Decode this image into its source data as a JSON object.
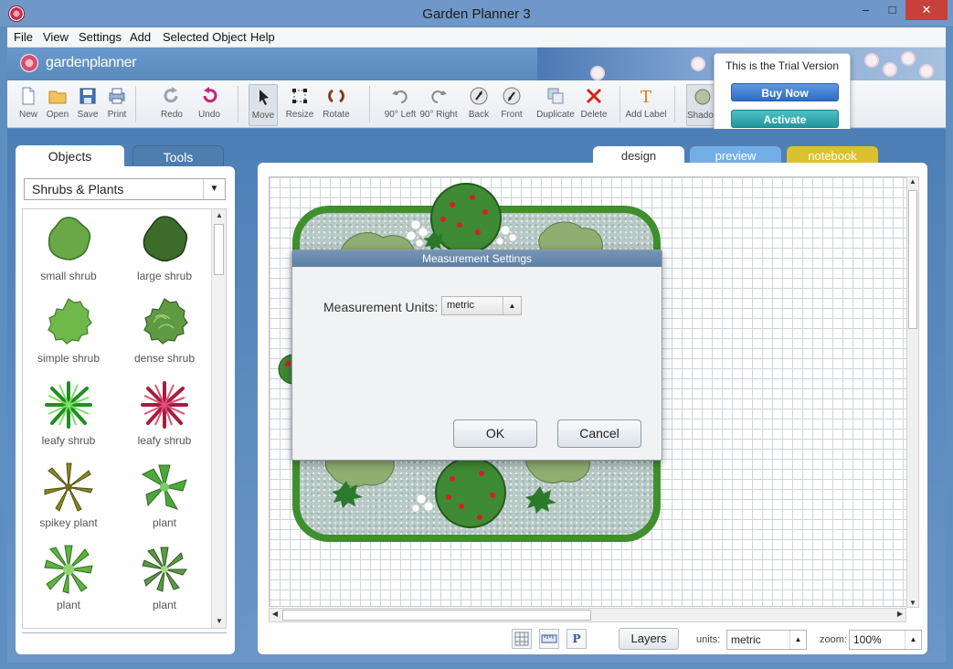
{
  "window": {
    "title": "Garden Planner 3",
    "minimize": "–",
    "maximize": "□",
    "close": "✕"
  },
  "menu": {
    "items": [
      "File",
      "View",
      "Settings",
      "Add",
      "Selected Object",
      "Help"
    ]
  },
  "brand": {
    "logo_text": "gardenplanner"
  },
  "toolbar": {
    "tools": [
      {
        "label": "New",
        "icon": "new-document-icon"
      },
      {
        "label": "Open",
        "icon": "open-folder-icon"
      },
      {
        "label": "Save",
        "icon": "save-disk-icon"
      },
      {
        "label": "Print",
        "icon": "printer-icon"
      },
      {
        "label": "Redo",
        "icon": "redo-icon"
      },
      {
        "label": "Undo",
        "icon": "undo-icon"
      },
      {
        "label": "Move",
        "icon": "pointer-arrow-icon",
        "active": true
      },
      {
        "label": "Resize",
        "icon": "resize-icon"
      },
      {
        "label": "Rotate",
        "icon": "rotate-icon"
      },
      {
        "label": "90° Left",
        "icon": "rotate-left-icon"
      },
      {
        "label": "90° Right",
        "icon": "rotate-right-icon"
      },
      {
        "label": "Back",
        "icon": "send-back-icon"
      },
      {
        "label": "Front",
        "icon": "bring-front-icon"
      },
      {
        "label": "Duplicate",
        "icon": "duplicate-icon"
      },
      {
        "label": "Delete",
        "icon": "delete-x-icon"
      },
      {
        "label": "Add Label",
        "icon": "text-label-icon"
      },
      {
        "label": "Shadow",
        "icon": "shadow-icon"
      }
    ]
  },
  "trial": {
    "message": "This is the Trial Version",
    "buy_label": "Buy Now",
    "activate_label": "Activate"
  },
  "left_panel": {
    "tabs": {
      "objects": "Objects",
      "tools": "Tools"
    },
    "category": "Shrubs & Plants",
    "items": [
      {
        "label": "small shrub"
      },
      {
        "label": "large shrub"
      },
      {
        "label": "simple shrub"
      },
      {
        "label": "dense shrub"
      },
      {
        "label": "leafy shrub"
      },
      {
        "label": "leafy shrub"
      },
      {
        "label": "spikey plant"
      },
      {
        "label": "plant"
      },
      {
        "label": "plant"
      },
      {
        "label": "plant"
      }
    ]
  },
  "view_tabs": {
    "design": "design",
    "preview": "preview",
    "notebook": "notebook"
  },
  "dialog": {
    "title": "Measurement Settings",
    "units_label": "Measurement Units:",
    "units_value": "metric",
    "ok_label": "OK",
    "cancel_label": "Cancel"
  },
  "status": {
    "grid_icon": "grid-icon",
    "ruler_icon": "ruler-icon",
    "p_label": "P",
    "layers_label": "Layers",
    "units_label": "units:",
    "units_value": "metric",
    "zoom_label": "zoom:",
    "zoom_value": "100%"
  },
  "colors": {
    "frame": "#6f98c8",
    "buy_button": "#2f6cc4",
    "activate_button": "#23959d",
    "notebook_tab": "#dbc12d",
    "preview_tab": "#74aee6",
    "close_button": "#c7413a"
  }
}
